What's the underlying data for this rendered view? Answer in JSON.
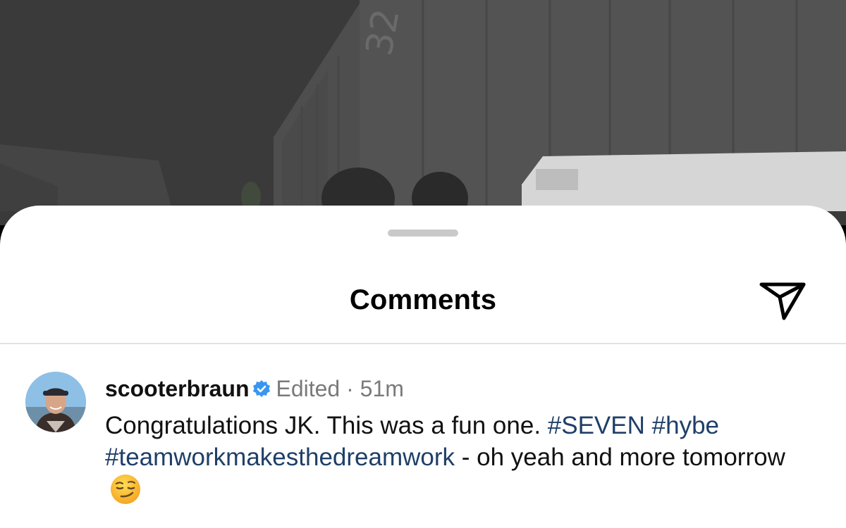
{
  "sheet": {
    "title": "Comments",
    "share_icon": "send-paper-plane-icon"
  },
  "comment": {
    "username": "scooterbraun",
    "verified_icon": "verified-badge-icon",
    "status": "Edited",
    "separator": "·",
    "time": "51m",
    "text_start": "Congratulations JK. This was a fun one.",
    "hashtags": [
      "#SEVEN",
      "#hybe",
      "#teamworkmakesthedreamwork"
    ],
    "text_end": "- oh yeah and more tomorrow",
    "emoji": "smirking-face-emoji"
  },
  "colors": {
    "hashtag": "#1f3f68",
    "meta_text": "#7a7a7a",
    "verified_badge": "#3897f0",
    "sheet_background": "#ffffff",
    "overlay_background": "#3b3b3b"
  }
}
